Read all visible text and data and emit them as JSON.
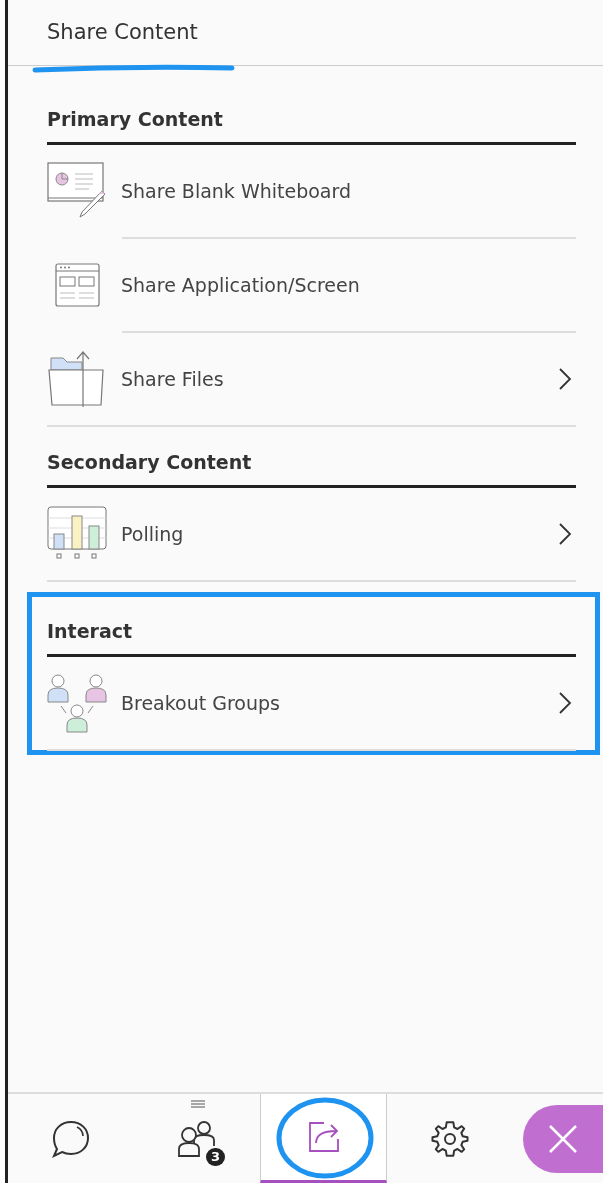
{
  "panel": {
    "title": "Share Content"
  },
  "sections": [
    {
      "title": "Primary Content",
      "items": [
        {
          "kind": "whiteboard",
          "label": "Share Blank Whiteboard",
          "has_submenu": false
        },
        {
          "kind": "screen",
          "label": "Share Application/Screen",
          "has_submenu": false
        },
        {
          "kind": "files",
          "label": "Share Files",
          "has_submenu": true
        }
      ]
    },
    {
      "title": "Secondary Content",
      "items": [
        {
          "kind": "polling",
          "label": "Polling",
          "has_submenu": true
        }
      ]
    },
    {
      "title": "Interact",
      "highlighted": true,
      "items": [
        {
          "kind": "groups",
          "label": "Breakout Groups",
          "has_submenu": true
        }
      ]
    }
  ],
  "bottom_bar": {
    "tabs": [
      {
        "kind": "chat",
        "selected": false
      },
      {
        "kind": "participants",
        "selected": false,
        "badge": "3"
      },
      {
        "kind": "share",
        "selected": true
      },
      {
        "kind": "settings",
        "selected": false
      }
    ]
  }
}
